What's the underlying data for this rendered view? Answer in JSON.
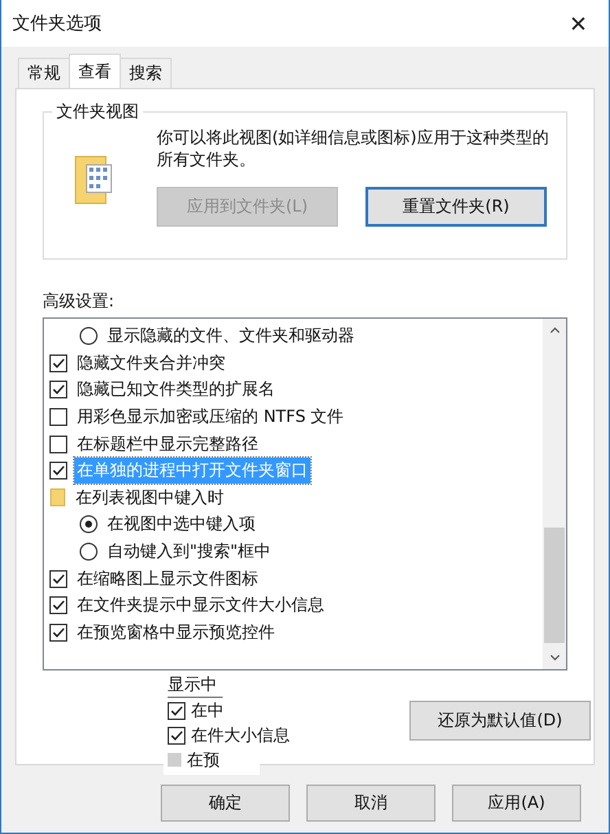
{
  "window": {
    "title": "文件夹选项",
    "close": "✕"
  },
  "tabs": [
    {
      "label": "常规",
      "selected": false
    },
    {
      "label": "查看",
      "selected": true
    },
    {
      "label": "搜索",
      "selected": false
    }
  ],
  "folder_views": {
    "title": "文件夹视图",
    "description": "你可以将此视图(如详细信息或图标)应用于这种类型的所有文件夹。",
    "buttons": [
      {
        "label": "应用到文件夹(L)",
        "disabled": true
      },
      {
        "label": "重置文件夹(R)",
        "disabled": false
      }
    ]
  },
  "advanced": {
    "title": "高级设置:",
    "items": [
      {
        "kind": "continued",
        "children": [
          {
            "kind": "radio",
            "label": "显示隐藏的文件、文件夹和驱动器",
            "checked": false,
            "selected": false
          }
        ]
      },
      {
        "kind": "checkbox",
        "label": "隐藏文件夹合并冲突",
        "checked": true,
        "selected": false
      },
      {
        "kind": "checkbox",
        "label": "隐藏已知文件类型的扩展名",
        "checked": true,
        "selected": false
      },
      {
        "kind": "checkbox",
        "label": "用彩色显示加密或压缩的 NTFS 文件",
        "checked": false,
        "selected": false
      },
      {
        "kind": "checkbox",
        "label": "在标题栏中显示完整路径",
        "checked": false,
        "selected": false
      },
      {
        "kind": "checkbox",
        "label": "在单独的进程中打开文件夹窗口",
        "checked": true,
        "selected": true
      },
      {
        "kind": "folder",
        "label": "在列表视图中键入时",
        "selected": false,
        "children": [
          {
            "kind": "radio",
            "label": "在视图中选中键入项",
            "checked": true,
            "selected": false
          },
          {
            "kind": "radio",
            "label": "自动键入到\"搜索\"框中",
            "checked": false,
            "selected": false
          }
        ]
      },
      {
        "kind": "checkbox",
        "label": "在缩略图上显示文件图标",
        "checked": true,
        "selected": false
      },
      {
        "kind": "checkbox",
        "label": "在文件夹提示中显示文件大小信息",
        "checked": true,
        "selected": false
      },
      {
        "kind": "checkbox",
        "label": "在预览窗格中显示预览控件",
        "checked": true,
        "selected": false
      }
    ],
    "restore_button": "还原为默认值(D)"
  },
  "overlay": {
    "title": "显示中",
    "items": [
      {
        "kind": "checkbox",
        "label": "在中",
        "checked": true
      },
      {
        "kind": "checkbox",
        "label": "在件大小信息",
        "checked": true
      },
      {
        "kind": "text",
        "label": "在预"
      }
    ]
  },
  "buttons": [
    "确定",
    "取消",
    "应用(A)"
  ]
}
